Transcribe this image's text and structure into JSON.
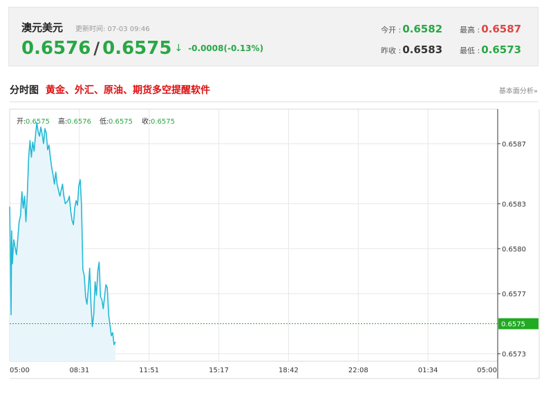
{
  "quote": {
    "name": "澳元美元",
    "update_label": "更新时间: 07-03 09:46",
    "bid": "0.6576",
    "separator": "/",
    "ask": "0.6575",
    "arrow": "↓",
    "change": "-0.0008(-0.13%)"
  },
  "stats": {
    "open_label": "今开 :",
    "open_value": "0.6582",
    "high_label": "最高 :",
    "high_value": "0.6587",
    "prev_close_label": "昨收 :",
    "prev_close_value": "0.6583",
    "low_label": "最低 :",
    "low_value": "0.6573"
  },
  "section": {
    "title": "分时图",
    "promo": "黄金、外汇、原油、期货多空提醒软件",
    "fundamental_link": "基本面分析»"
  },
  "ohlc": {
    "open_label": "开:",
    "open_value": "0.6575",
    "high_label": "高:",
    "high_value": "0.6576",
    "low_label": "低:",
    "low_value": "0.6575",
    "close_label": "收:",
    "close_value": "0.6575"
  },
  "colors": {
    "line": "#23b8d6",
    "fill": "#e8f6fb",
    "green": "#28a745",
    "red": "#e04444",
    "current_badge": "#22aa22"
  },
  "chart_data": {
    "type": "area",
    "x_tick_labels": [
      "05:00",
      "08:31",
      "11:51",
      "15:17",
      "18:42",
      "22:08",
      "01:34",
      "05:00"
    ],
    "y_tick_labels": [
      "0.6587",
      "0.6583",
      "0.6580",
      "0.6577",
      "0.6575",
      "0.6573"
    ],
    "y_ticks": [
      0.6587,
      0.6583,
      0.658,
      0.6577,
      0.6575,
      0.6573
    ],
    "current_price": 0.6575,
    "current_price_label": "0.6575",
    "ylim": [
      0.65725,
      0.65893
    ],
    "x_range_minutes": [
      0,
      1440
    ],
    "grid": true,
    "series": [
      {
        "x": [
          0,
          2,
          4,
          6,
          8,
          12,
          16,
          20,
          24,
          28,
          32,
          36,
          40,
          44,
          48,
          52,
          56,
          60,
          64,
          68,
          72,
          76,
          80,
          84,
          88,
          92,
          96,
          100,
          104,
          108,
          112,
          116,
          120,
          124,
          128,
          132,
          136,
          140,
          144,
          148,
          152,
          156,
          160,
          164,
          168,
          172,
          176,
          180,
          184,
          188,
          192,
          196,
          200,
          204,
          208,
          212,
          216,
          220,
          224,
          228,
          232,
          236,
          240,
          244,
          248,
          252,
          256,
          260,
          264,
          268,
          272,
          276,
          280,
          284,
          288,
          292,
          296,
          300,
          304,
          308,
          312
        ],
        "y": [
          0.65828,
          0.65799,
          0.65756,
          0.65812,
          0.6579,
          0.65806,
          0.65801,
          0.65796,
          0.65807,
          0.65818,
          0.65822,
          0.65838,
          0.65827,
          0.65835,
          0.65818,
          0.65836,
          0.65861,
          0.65872,
          0.65861,
          0.65871,
          0.65865,
          0.65875,
          0.65884,
          0.65878,
          0.65875,
          0.65881,
          0.65876,
          0.6587,
          0.6588,
          0.65877,
          0.65866,
          0.65869,
          0.65861,
          0.65854,
          0.65849,
          0.65843,
          0.65851,
          0.65843,
          0.65839,
          0.65835,
          0.65839,
          0.65843,
          0.65835,
          0.6583,
          0.65831,
          0.65832,
          0.65835,
          0.65825,
          0.65819,
          0.65816,
          0.65827,
          0.65832,
          0.65829,
          0.65842,
          0.65846,
          0.65829,
          0.65786,
          0.65782,
          0.65768,
          0.65763,
          0.65773,
          0.65787,
          0.65762,
          0.65748,
          0.65756,
          0.65778,
          0.65769,
          0.65785,
          0.65791,
          0.65768,
          0.65766,
          0.6576,
          0.65768,
          0.65776,
          0.65774,
          0.65756,
          0.65749,
          0.65742,
          0.65744,
          0.65736,
          0.65738
        ]
      }
    ]
  }
}
